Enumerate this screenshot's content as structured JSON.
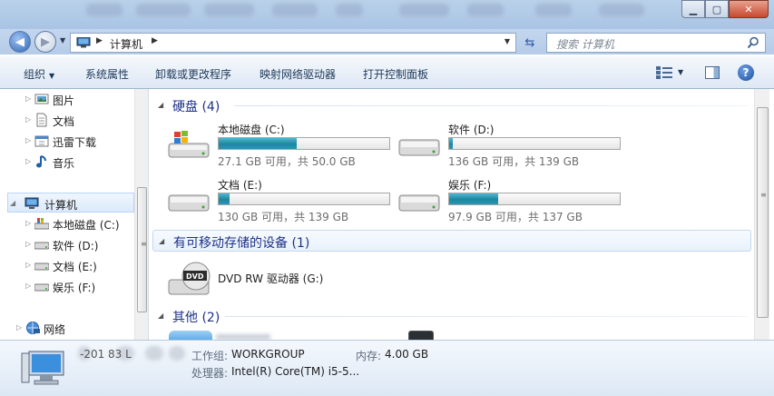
{
  "window": {
    "controls": {
      "minimize": "▁",
      "maximize": "▢",
      "close": "✕"
    }
  },
  "address": {
    "location": "计算机",
    "search_placeholder": "搜索 计算机"
  },
  "toolbar": {
    "organize": "组织",
    "system_properties": "系统属性",
    "uninstall": "卸载或更改程序",
    "map_drive": "映射网络驱动器",
    "control_panel": "打开控制面板"
  },
  "nav": {
    "items": [
      {
        "label": "图片",
        "icon": "pictures-icon"
      },
      {
        "label": "文档",
        "icon": "documents-icon"
      },
      {
        "label": "迅雷下载",
        "icon": "downloads-icon"
      },
      {
        "label": "音乐",
        "icon": "music-icon"
      },
      {
        "label": "计算机",
        "icon": "computer-icon"
      },
      {
        "label": "本地磁盘 (C:)",
        "icon": "windows-drive-icon"
      },
      {
        "label": "软件 (D:)",
        "icon": "drive-icon"
      },
      {
        "label": "文档 (E:)",
        "icon": "drive-icon"
      },
      {
        "label": "娱乐 (F:)",
        "icon": "drive-icon"
      },
      {
        "label": "网络",
        "icon": "network-icon"
      }
    ]
  },
  "groups": {
    "hard_disks": "硬盘 (4)",
    "removable": "有可移动存储的设备 (1)",
    "other": "其他 (2)"
  },
  "drives": [
    {
      "name": "本地磁盘 (C:)",
      "free": "27.1 GB 可用，共 50.0 GB",
      "used_fraction": 0.458
    },
    {
      "name": "软件 (D:)",
      "free": "136 GB 可用，共 139 GB",
      "used_fraction": 0.022
    },
    {
      "name": "文档 (E:)",
      "free": "130 GB 可用，共 139 GB",
      "used_fraction": 0.065
    },
    {
      "name": "娱乐 (F:)",
      "free": "97.9 GB 可用，共 137 GB",
      "used_fraction": 0.285
    }
  ],
  "removable": [
    {
      "name": "DVD RW 驱动器 (G:)",
      "badge": "DVD"
    }
  ],
  "details": {
    "computer_name_partial": "-201  83  L",
    "workgroup_label": "工作组:",
    "workgroup": "WORKGROUP",
    "memory_label": "内存:",
    "memory": "4.00 GB",
    "processor_label": "处理器:",
    "processor": "Intel(R) Core(TM) i5-5..."
  }
}
